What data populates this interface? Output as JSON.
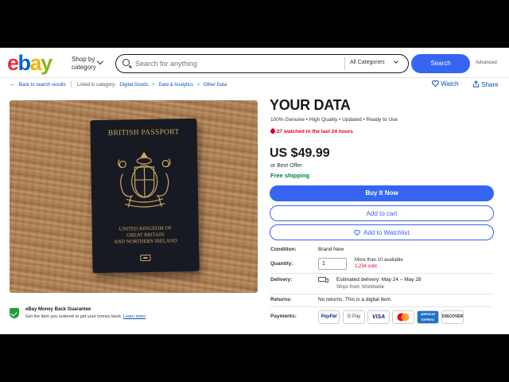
{
  "header": {
    "logo_letters": [
      "e",
      "b",
      "a",
      "y"
    ],
    "shop_by_line1": "Shop by",
    "shop_by_line2": "category",
    "search_placeholder": "Search for anything",
    "category_select": "All Categories",
    "search_button": "Search",
    "advanced_link": "Advanced"
  },
  "breadcrumb": {
    "back_label": "Back to search results",
    "listed_in": "Listed in category:",
    "items": [
      "Digital Goods",
      "Data & Analytics",
      "Other Data"
    ],
    "separator": ">"
  },
  "actions": {
    "watch_label": "Watch",
    "share_label": "Share"
  },
  "image": {
    "passport_title": "BRITISH PASSPORT",
    "passport_line1": "UNITED KINGDOM OF",
    "passport_line2": "GREAT BRITAIN",
    "passport_line3": "AND NORTHERN IRELAND",
    "cover_color": "#181a23",
    "gold_color": "#c9a760"
  },
  "guarantee": {
    "title": "eBay Money Back Guarantee",
    "text": "Get the item you ordered or get your money back.",
    "learn_more": "Learn more"
  },
  "listing": {
    "title": "YOUR DATA",
    "subtitle": "100% Genuine • High Quality • Updated • Ready to Use",
    "watched": "27 watched in the last 24 hours",
    "price": "US $49.99",
    "best_offer": "or Best Offer",
    "shipping": "Free shipping",
    "buy_now": "Buy It Now",
    "add_to_cart": "Add to cart",
    "add_to_watchlist": "Add to Watchlist"
  },
  "details": {
    "condition_label": "Condition:",
    "condition_value": "Brand New",
    "quantity_label": "Quantity:",
    "quantity_value": "1",
    "available": "More than 10 available",
    "sold": "1,234 sold",
    "delivery_label": "Delivery:",
    "delivery_estimate": "Estimated delivery: May 24 – May 28",
    "ships_from": "Ships from: Worldwide",
    "returns_label": "Returns:",
    "returns_value": "No returns. This is a digital item.",
    "payments_label": "Payments:"
  },
  "payments": [
    "PayPal",
    "G Pay",
    "VISA",
    "Mastercard",
    "AMERICAN EXPRESS",
    "DISCOVER"
  ],
  "colors": {
    "accent": "#3665f3",
    "link": "#0654ba",
    "alert": "#e0001b",
    "success": "#05823f"
  }
}
